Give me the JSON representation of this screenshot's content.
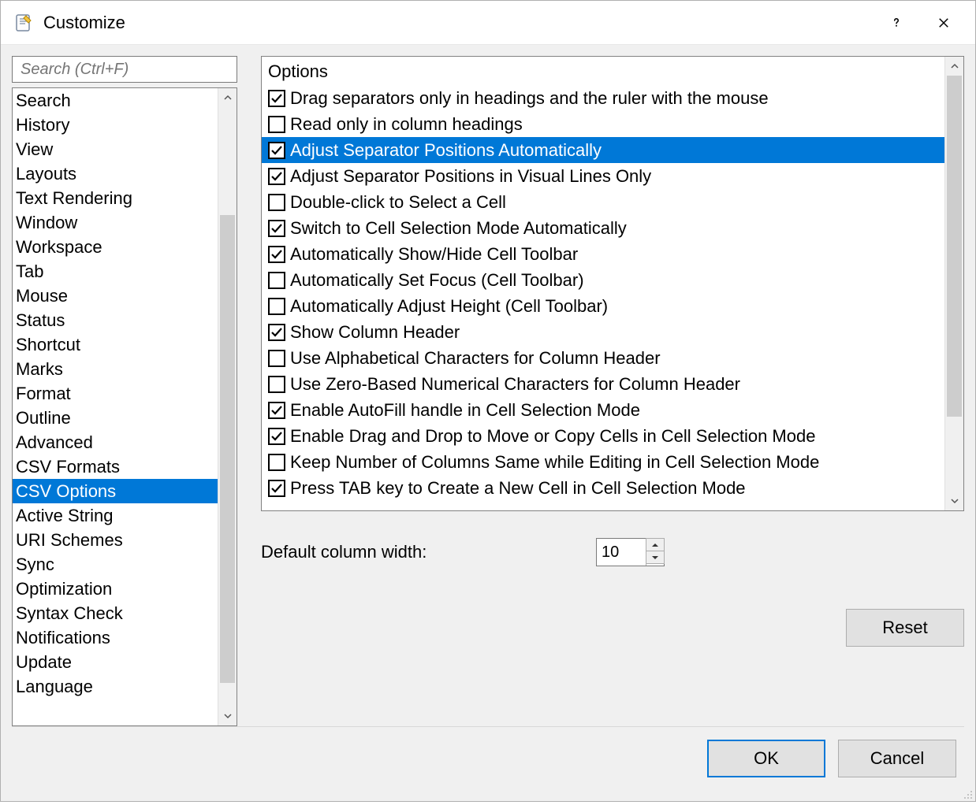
{
  "titlebar": {
    "title": "Customize"
  },
  "search": {
    "placeholder": "Search (Ctrl+F)"
  },
  "categories": [
    {
      "label": "Search",
      "selected": false
    },
    {
      "label": "History",
      "selected": false
    },
    {
      "label": "View",
      "selected": false
    },
    {
      "label": "Layouts",
      "selected": false
    },
    {
      "label": "Text Rendering",
      "selected": false
    },
    {
      "label": "Window",
      "selected": false
    },
    {
      "label": "Workspace",
      "selected": false
    },
    {
      "label": "Tab",
      "selected": false
    },
    {
      "label": "Mouse",
      "selected": false
    },
    {
      "label": "Status",
      "selected": false
    },
    {
      "label": "Shortcut",
      "selected": false
    },
    {
      "label": "Marks",
      "selected": false
    },
    {
      "label": "Format",
      "selected": false
    },
    {
      "label": "Outline",
      "selected": false
    },
    {
      "label": "Advanced",
      "selected": false
    },
    {
      "label": "CSV Formats",
      "selected": false
    },
    {
      "label": "CSV Options",
      "selected": true
    },
    {
      "label": "Active String",
      "selected": false
    },
    {
      "label": "URI Schemes",
      "selected": false
    },
    {
      "label": "Sync",
      "selected": false
    },
    {
      "label": "Optimization",
      "selected": false
    },
    {
      "label": "Syntax Check",
      "selected": false
    },
    {
      "label": "Notifications",
      "selected": false
    },
    {
      "label": "Update",
      "selected": false
    },
    {
      "label": "Language",
      "selected": false
    }
  ],
  "category_scroll": {
    "thumb_top_pct": 18,
    "thumb_height_pct": 78
  },
  "options": {
    "header": "Options",
    "items": [
      {
        "label": "Drag separators only in headings and the ruler with the mouse",
        "checked": true,
        "selected": false
      },
      {
        "label": "Read only in column headings",
        "checked": false,
        "selected": false
      },
      {
        "label": "Adjust Separator Positions Automatically",
        "checked": true,
        "selected": true
      },
      {
        "label": "Adjust Separator Positions in Visual Lines Only",
        "checked": true,
        "selected": false
      },
      {
        "label": "Double-click to Select a Cell",
        "checked": false,
        "selected": false
      },
      {
        "label": "Switch to Cell Selection Mode Automatically",
        "checked": true,
        "selected": false
      },
      {
        "label": "Automatically Show/Hide Cell Toolbar",
        "checked": true,
        "selected": false
      },
      {
        "label": "Automatically Set Focus (Cell Toolbar)",
        "checked": false,
        "selected": false
      },
      {
        "label": "Automatically Adjust Height (Cell Toolbar)",
        "checked": false,
        "selected": false
      },
      {
        "label": "Show Column Header",
        "checked": true,
        "selected": false
      },
      {
        "label": "Use Alphabetical Characters for Column Header",
        "checked": false,
        "selected": false
      },
      {
        "label": "Use Zero-Based Numerical Characters for Column Header",
        "checked": false,
        "selected": false
      },
      {
        "label": "Enable AutoFill handle in Cell Selection Mode",
        "checked": true,
        "selected": false
      },
      {
        "label": "Enable Drag and Drop to Move or Copy Cells in Cell Selection Mode",
        "checked": true,
        "selected": false
      },
      {
        "label": "Keep Number of Columns Same while Editing in Cell Selection Mode",
        "checked": false,
        "selected": false
      },
      {
        "label": "Press TAB key to Create a New Cell in Cell Selection Mode",
        "checked": true,
        "selected": false
      }
    ],
    "scroll": {
      "thumb_top_pct": 0,
      "thumb_height_pct": 82
    }
  },
  "fields": {
    "default_column_width_label": "Default column width:",
    "default_column_width_value": "10"
  },
  "buttons": {
    "reset": "Reset",
    "ok": "OK",
    "cancel": "Cancel"
  }
}
